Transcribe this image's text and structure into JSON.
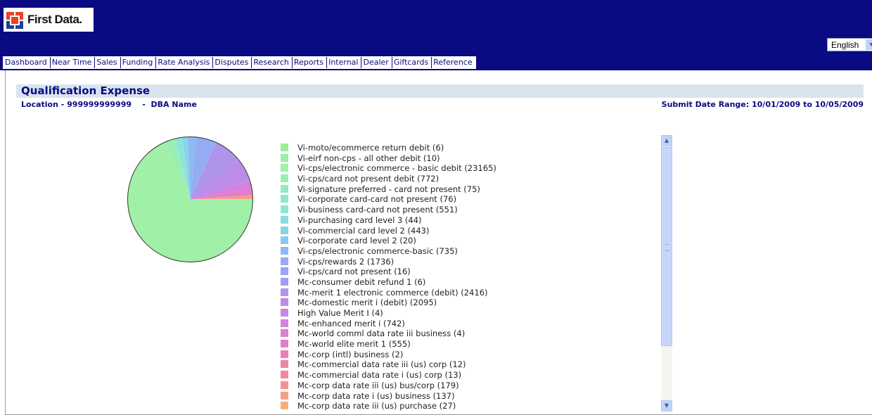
{
  "header": {
    "logo_text": "First Data."
  },
  "language": {
    "selected": "English"
  },
  "nav": {
    "items": [
      "Dashboard",
      "Near Time",
      "Sales",
      "Funding",
      "Rate Analysis",
      "Disputes",
      "Research",
      "Reports",
      "Internal",
      "Dealer",
      "Giftcards",
      "Reference"
    ]
  },
  "report": {
    "title": "Qualification Expense",
    "location": "Location - 999999999999    -  DBA Name",
    "date_range": "Submit Date Range: 10/01/2009 to 10/05/2009"
  },
  "chart_data": {
    "type": "pie",
    "slices": [
      {
        "label": "Vi-moto/ecommerce return debit (6)",
        "value": 6,
        "color": "#99ee99"
      },
      {
        "label": "Vi-eirf non-cps - all other debit (10)",
        "value": 10,
        "color": "#9eeea4"
      },
      {
        "label": "Vi-cps/electronic commerce - basic debit (23165)",
        "value": 23165,
        "color": "#a0f0a8"
      },
      {
        "label": "Vi-cps/card not present debit (772)",
        "value": 772,
        "color": "#99eeb4"
      },
      {
        "label": "Vi-signature preferred - card not present (75)",
        "value": 75,
        "color": "#94e8c0"
      },
      {
        "label": "Vi-corporate card-card not present (76)",
        "value": 76,
        "color": "#90e6cc"
      },
      {
        "label": "Vi-business card-card not present (551)",
        "value": 551,
        "color": "#8ce4d8"
      },
      {
        "label": "Vi-purchasing card level 3 (44)",
        "value": 44,
        "color": "#88dde0"
      },
      {
        "label": "Vi-commercial card level 2 (443)",
        "value": 443,
        "color": "#86d4e8"
      },
      {
        "label": "Vi-corporate card level 2 (20)",
        "value": 20,
        "color": "#88c8f0"
      },
      {
        "label": "Vi-cps/electronic commerce-basic (735)",
        "value": 735,
        "color": "#8cbaf2"
      },
      {
        "label": "Vi-cps/rewards 2 (1736)",
        "value": 1736,
        "color": "#94acf4"
      },
      {
        "label": "Vi-cps/card not present (16)",
        "value": 16,
        "color": "#9aa4f2"
      },
      {
        "label": "Mc-consumer debit refund 1 (6)",
        "value": 6,
        "color": "#a49cee"
      },
      {
        "label": "Mc-merit 1 electronic commerce (debit) (2416)",
        "value": 2416,
        "color": "#b094ec"
      },
      {
        "label": "Mc-domestic merit i (debit) (2095)",
        "value": 2095,
        "color": "#bc8ce8"
      },
      {
        "label": "High Value Merit I (4)",
        "value": 4,
        "color": "#c886e4"
      },
      {
        "label": "Mc-enhanced merit i (742)",
        "value": 742,
        "color": "#d482dc"
      },
      {
        "label": "Mc-world comml data rate iii business (4)",
        "value": 4,
        "color": "#de80d0"
      },
      {
        "label": "Mc-world elite merit 1 (555)",
        "value": 555,
        "color": "#e47ec4"
      },
      {
        "label": "Mc-corp (intl) business (2)",
        "value": 2,
        "color": "#ea80b4"
      },
      {
        "label": "Mc-commercial data rate iii (us) corp (12)",
        "value": 12,
        "color": "#ee84a6"
      },
      {
        "label": "Mc-commercial data rate i (us) corp (13)",
        "value": 13,
        "color": "#f08a98"
      },
      {
        "label": "Mc-corp data rate iii (us) bus/corp (179)",
        "value": 179,
        "color": "#f2948c"
      },
      {
        "label": "Mc-corp data rate i (us) business (137)",
        "value": 137,
        "color": "#f4a086"
      },
      {
        "label": "Mc-corp data rate iii (us) purchase (27)",
        "value": 27,
        "color": "#f6b080"
      }
    ]
  }
}
